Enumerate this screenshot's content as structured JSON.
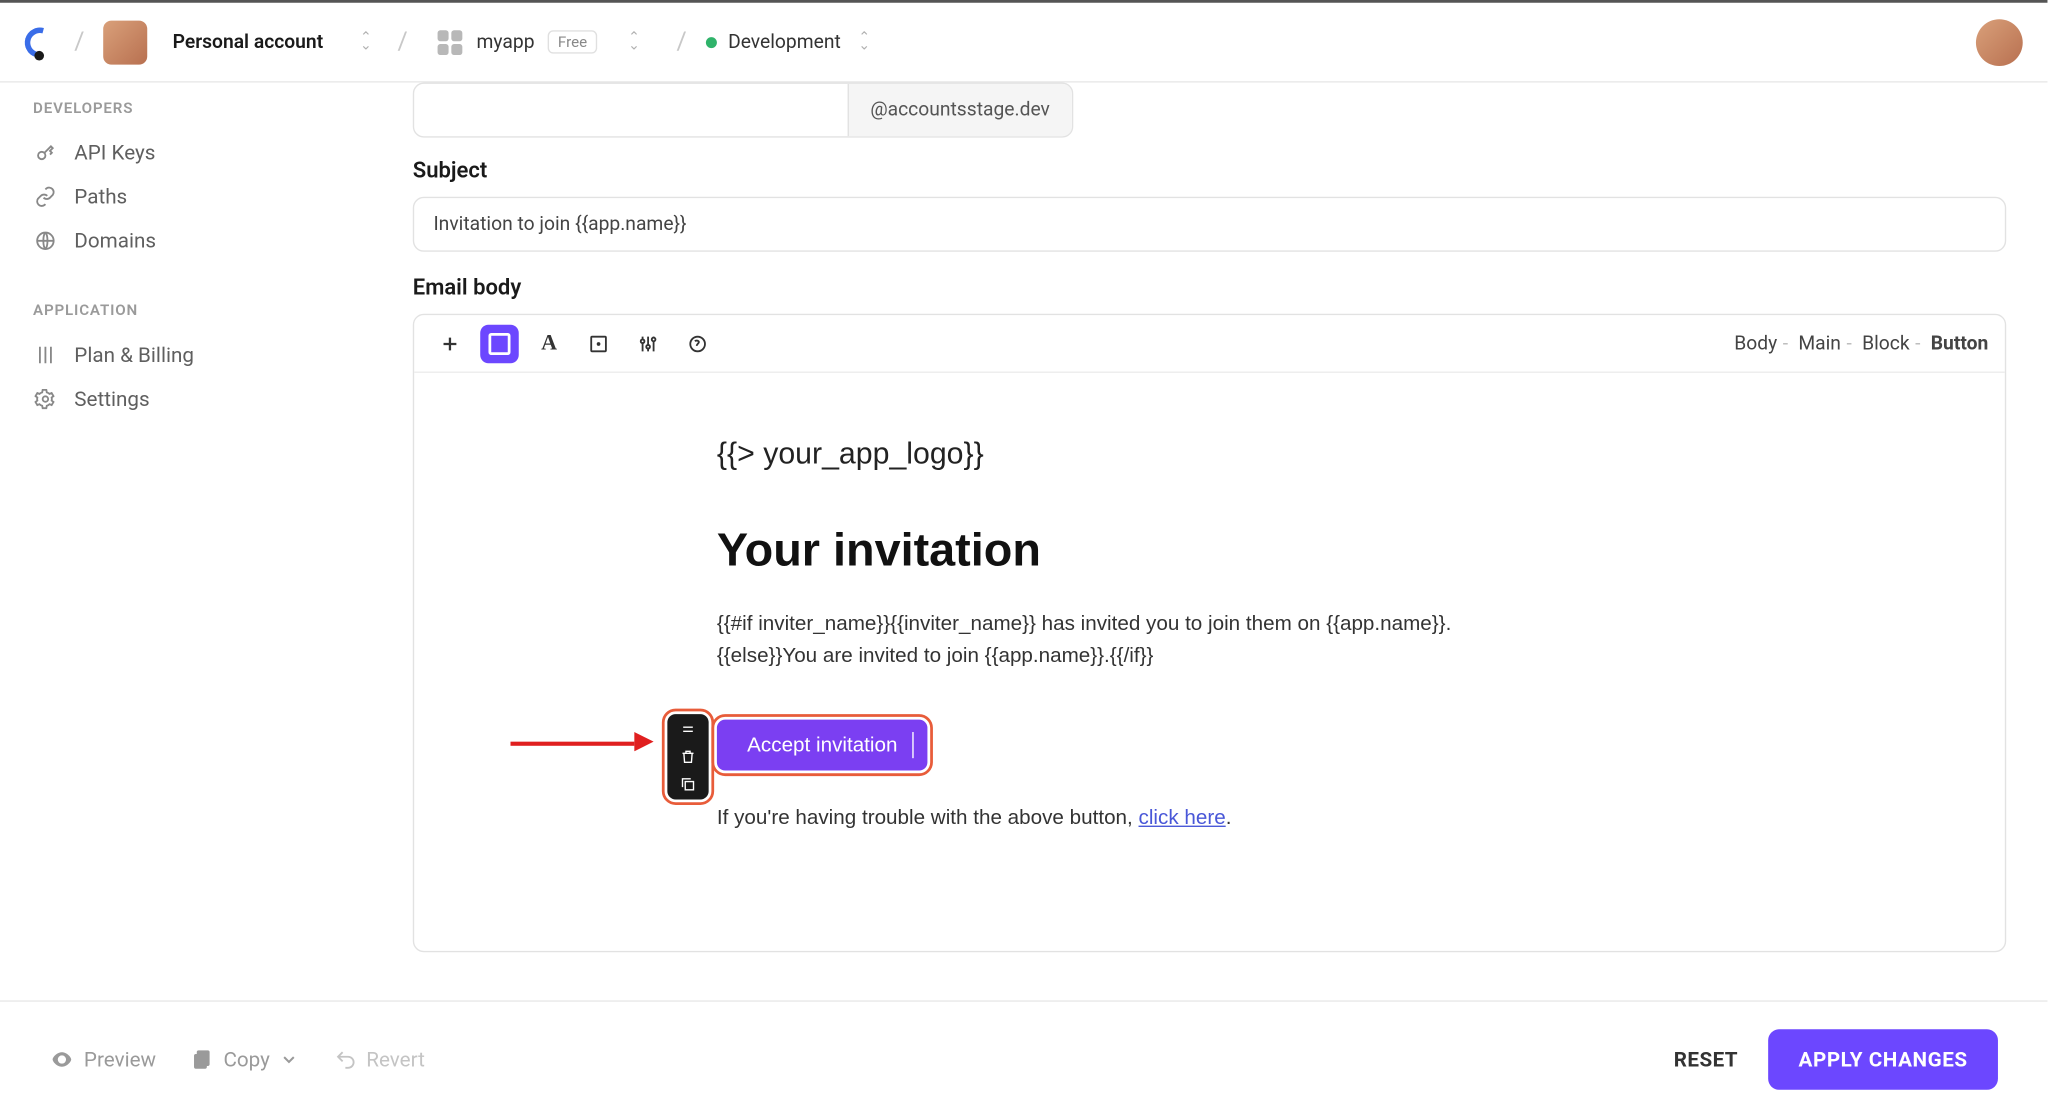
{
  "header": {
    "account_label": "Personal account",
    "app_name": "myapp",
    "plan_badge": "Free",
    "env_label": "Development"
  },
  "sidebar": {
    "group_developers": "DEVELOPERS",
    "group_application": "APPLICATION",
    "items_dev": [
      {
        "label": "API Keys"
      },
      {
        "label": "Paths"
      },
      {
        "label": "Domains"
      }
    ],
    "items_app": [
      {
        "label": "Plan & Billing"
      },
      {
        "label": "Settings"
      }
    ]
  },
  "form": {
    "domain_suffix": "@accountsstage.dev",
    "subject_label": "Subject",
    "subject_value": "Invitation to join {{app.name}}",
    "body_label": "Email body"
  },
  "editor_trail": {
    "body": "Body",
    "main": "Main",
    "block": "Block",
    "button": "Button"
  },
  "email": {
    "logo_partial": "{{> your_app_logo}}",
    "title": "Your invitation",
    "paragraph": "{{#if inviter_name}}{{inviter_name}} has invited you to join them on {{app.name}}.{{else}}You are invited to join {{app.name}}.{{/if}}",
    "button_label": "Accept invitation",
    "trouble_prefix": "If you're having trouble with the above button, ",
    "trouble_link": "click here"
  },
  "footer": {
    "preview": "Preview",
    "copy": "Copy",
    "revert": "Revert",
    "reset": "RESET",
    "apply": "APPLY CHANGES"
  }
}
